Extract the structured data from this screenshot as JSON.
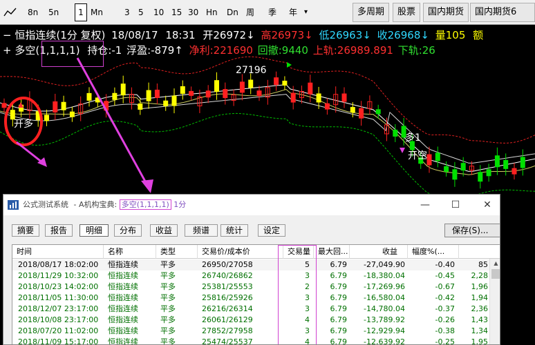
{
  "toolbar": {
    "buttons": [
      "8n",
      "5n",
      "1",
      "Mn",
      "3",
      "5",
      "10",
      "15",
      "30",
      "Hn",
      "Dn",
      "周",
      "季",
      "年"
    ],
    "selected": "1",
    "right_buttons": [
      "多周期",
      "股票",
      "国内期货",
      "国内期货6"
    ]
  },
  "quote": {
    "name": "恒指连续(1分 复权)",
    "date": "18/08/17",
    "time": "18:31",
    "open_label": "开",
    "open": "26972",
    "open_arrow": "↓",
    "high_label": "高",
    "high": "26973",
    "high_arrow": "↓",
    "low_label": "低",
    "low": "26963",
    "low_arrow": "↓",
    "close_label": "收",
    "close": "26968",
    "close_arrow": "↓",
    "volume_label": "量",
    "volume": "105",
    "amount_label": "额"
  },
  "strategy": {
    "name": "多空",
    "params": "(1,1,1,1)",
    "position": "持仓:-1",
    "floating": "浮盈:-879",
    "arrow": "↑",
    "net_profit": "净利:221690",
    "drawdown": "回撤:9440",
    "upper": "上轨:26989.891",
    "lower": "下轨:26"
  },
  "chart": {
    "price_label": "27196",
    "signal_open_long": "开多",
    "signal_long": "多1",
    "signal_open_short": "开空",
    "colors": {
      "bull": "#ff2020",
      "bear": "#ffff00",
      "down": "#00e000",
      "ma": "#ffffff",
      "upper": "#e02020",
      "lower": "#00c000",
      "highlight": "#e040e0"
    }
  },
  "dialog": {
    "title_app": "公式测试系统",
    "title_sep": "- A机构宝典:",
    "title_formula": "多空(1,1,1,1)",
    "title_period": "1分",
    "tabs": [
      "摘要",
      "报告",
      "明细",
      "分布",
      "收益",
      "频谱",
      "统计",
      "设定"
    ],
    "selected_tab": "明细",
    "save_label": "保存(S)...",
    "columns": [
      "时间",
      "名称",
      "类型",
      "交易价/成本价",
      "交易量",
      "最大回...",
      "收益",
      "幅度%(..."
    ],
    "rows": [
      {
        "time": "2018/08/17 18:02:00",
        "name": "恒指连续",
        "type": "平多",
        "price": "26950/27058",
        "qty": "5",
        "maxdd": "6.79",
        "profit": "-27,049.90",
        "pct": "-0.40",
        "extra": "85"
      },
      {
        "time": "2018/11/29 10:32:00",
        "name": "恒指连续",
        "type": "平多",
        "price": "26740/26862",
        "qty": "3",
        "maxdd": "6.79",
        "profit": "-18,380.04",
        "pct": "-0.45",
        "extra": "2,28"
      },
      {
        "time": "2018/10/23 14:02:00",
        "name": "恒指连续",
        "type": "平多",
        "price": "25381/25553",
        "qty": "2",
        "maxdd": "6.79",
        "profit": "-17,269.96",
        "pct": "-0.67",
        "extra": "1,96"
      },
      {
        "time": "2018/11/05 11:30:00",
        "name": "恒指连续",
        "type": "平多",
        "price": "25816/25926",
        "qty": "3",
        "maxdd": "6.79",
        "profit": "-16,580.04",
        "pct": "-0.42",
        "extra": "1,94"
      },
      {
        "time": "2018/12/07 23:17:00",
        "name": "恒指连续",
        "type": "平多",
        "price": "26216/26314",
        "qty": "3",
        "maxdd": "6.79",
        "profit": "-14,780.04",
        "pct": "-0.37",
        "extra": "2,36"
      },
      {
        "time": "2018/10/08 23:17:00",
        "name": "恒指连续",
        "type": "平多",
        "price": "26061/26129",
        "qty": "4",
        "maxdd": "6.79",
        "profit": "-13,789.92",
        "pct": "-0.26",
        "extra": "1,43"
      },
      {
        "time": "2018/07/20 11:02:00",
        "name": "恒指连续",
        "type": "平多",
        "price": "27852/27958",
        "qty": "3",
        "maxdd": "6.79",
        "profit": "-12,929.94",
        "pct": "-0.38",
        "extra": "1,34"
      },
      {
        "time": "2018/11/09 15:17:00",
        "name": "恒指连续",
        "type": "平多",
        "price": "25474/25537",
        "qty": "4",
        "maxdd": "6.79",
        "profit": "-12,639.92",
        "pct": "-0.25",
        "extra": "1,95"
      }
    ]
  }
}
